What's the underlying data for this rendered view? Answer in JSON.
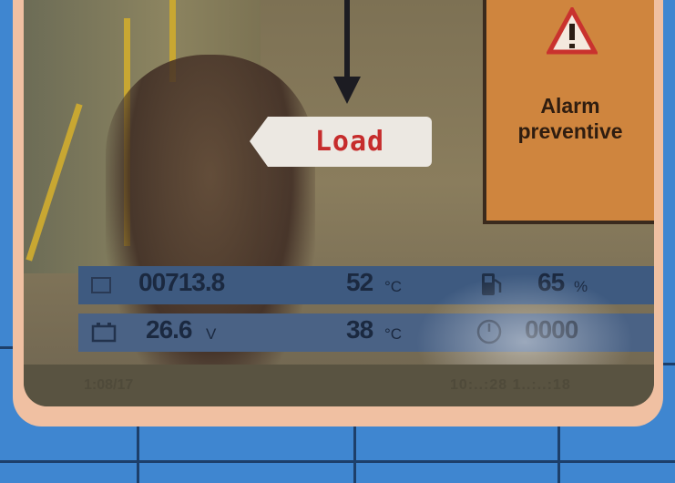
{
  "display": {
    "message": "Load",
    "alarm": {
      "line1": "Alarm",
      "line2": "preventive",
      "icon": "warning-triangle-icon"
    }
  },
  "status_bar": {
    "odometer": {
      "value": "00713.8",
      "unit": "",
      "icon": "odometer-icon"
    },
    "temp_1": {
      "value": "52",
      "unit": "°C",
      "icon": "coolant-temperature-icon"
    },
    "fuel": {
      "value": "65",
      "unit": "%",
      "icon": "fuel-pump-icon"
    },
    "voltage": {
      "value": "26.6",
      "unit": "V",
      "icon": "battery-icon"
    },
    "temp_2": {
      "value": "38",
      "unit": "°C",
      "icon": "oil-temperature-icon"
    },
    "hours": {
      "value": "0000",
      "unit": "",
      "icon": "service-gauge-icon"
    }
  },
  "footer": {
    "date": "1:08/17",
    "time": "10:..:28 1..:..:18"
  },
  "colors": {
    "alarm_bg": "#cf853e",
    "label_text": "#c62c2c",
    "status_bar": "#3e5a80"
  }
}
